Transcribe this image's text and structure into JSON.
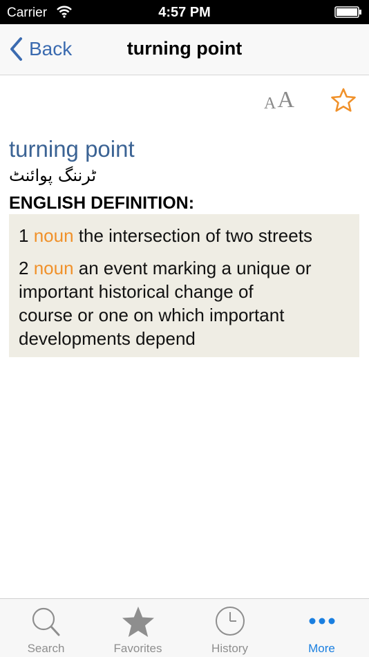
{
  "status_bar": {
    "carrier": "Carrier",
    "time": "4:57 PM"
  },
  "nav": {
    "back_label": "Back",
    "title": "turning point"
  },
  "tools": {
    "font_small": "A",
    "font_large": "A"
  },
  "entry": {
    "headword": "turning point",
    "translation": "ٹرننگ پوائنٹ",
    "section_heading": "ENGLISH DEFINITION:",
    "senses": [
      {
        "number": "1",
        "pos": "noun",
        "lines": [
          "the intersection of two streets"
        ]
      },
      {
        "number": "2",
        "pos": "noun",
        "lines": [
          "an event marking a unique or",
          "important historical change of",
          "course or one on which important",
          "developments depend"
        ]
      }
    ]
  },
  "tabs": [
    {
      "label": "Search",
      "icon": "search-icon"
    },
    {
      "label": "Favorites",
      "icon": "star-icon"
    },
    {
      "label": "History",
      "icon": "clock-icon"
    },
    {
      "label": "More",
      "icon": "more-icon",
      "active": true
    }
  ],
  "colors": {
    "accent": "#3b6bb0",
    "headword": "#3b6394",
    "pos": "#f0912a",
    "definition_bg": "#efede4",
    "tab_active": "#1a7fe0"
  }
}
